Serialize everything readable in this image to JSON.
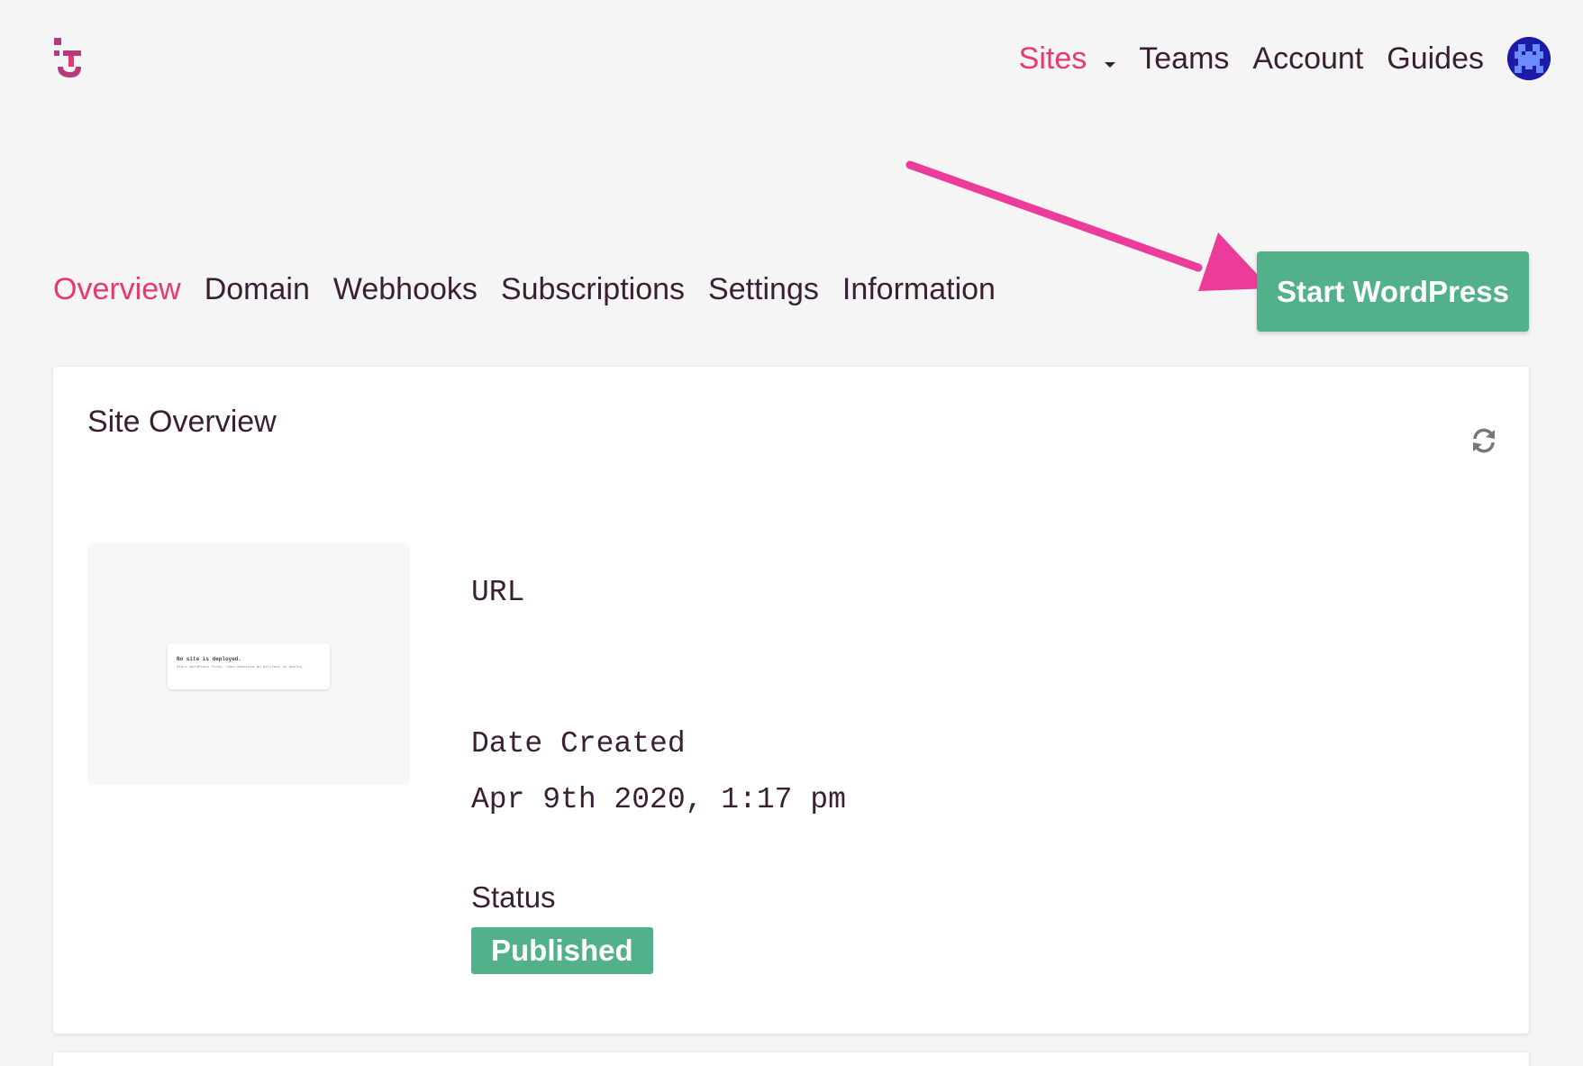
{
  "brand": {
    "logo_icon": "turbopress-logo-icon",
    "accent": "#e8386d",
    "primary_button": "#52b18b"
  },
  "topnav": {
    "items": [
      {
        "label": "Sites",
        "active": true
      },
      {
        "label": "Teams"
      },
      {
        "label": "Account"
      },
      {
        "label": "Guides"
      }
    ],
    "avatar_icon": "pixel-avatar-icon"
  },
  "tabs": [
    {
      "label": "Overview",
      "active": true
    },
    {
      "label": "Domain"
    },
    {
      "label": "Webhooks"
    },
    {
      "label": "Subscriptions"
    },
    {
      "label": "Settings"
    },
    {
      "label": "Information"
    }
  ],
  "actions": {
    "start_label": "Start WordPress"
  },
  "overview": {
    "title": "Site Overview",
    "refresh_icon": "refresh-icon",
    "preview": {
      "heading": "No site is deployed.",
      "text": "Start WordPress first, then Generate an Artifact to deploy."
    },
    "url_label": "URL",
    "url_value": "",
    "date_label": "Date Created",
    "date_value": "Apr 9th 2020, 1:17 pm",
    "status_label": "Status",
    "status_value": "Published"
  }
}
